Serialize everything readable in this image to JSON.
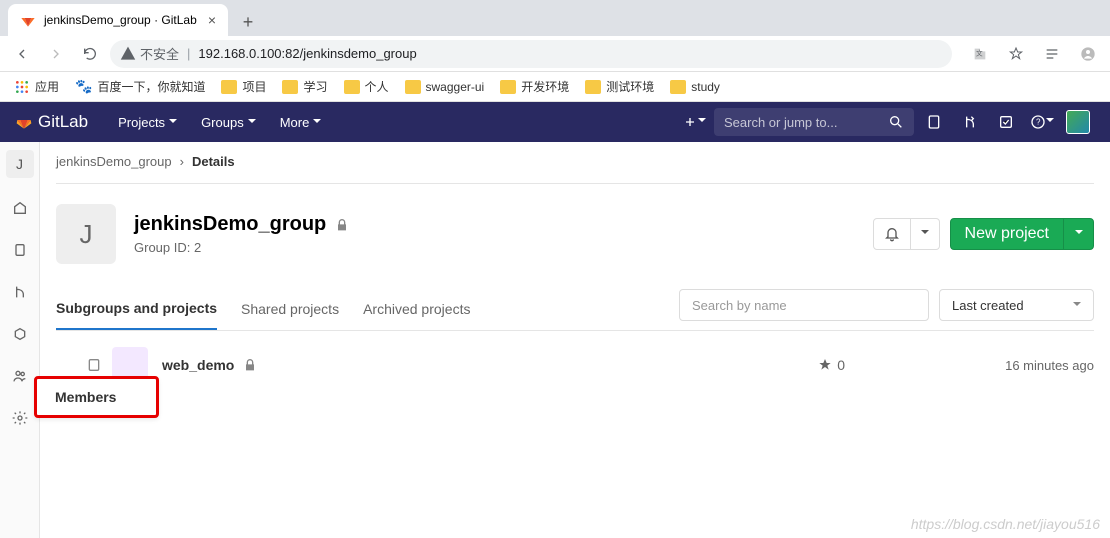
{
  "browser": {
    "tab_title": "jenkinsDemo_group · GitLab",
    "url_warning": "不安全",
    "url": "192.168.0.100:82/jenkinsdemo_group"
  },
  "bookmarks": {
    "apps": "应用",
    "items": [
      "百度一下，你就知道",
      "项目",
      "学习",
      "个人",
      "swagger-ui",
      "开发环境",
      "测试环境",
      "study"
    ]
  },
  "nav": {
    "brand": "GitLab",
    "projects": "Projects",
    "groups": "Groups",
    "more": "More",
    "search_placeholder": "Search or jump to..."
  },
  "sidebar": {
    "avatar_letter": "J"
  },
  "breadcrumb": {
    "group": "jenkinsDemo_group",
    "page": "Details"
  },
  "group": {
    "avatar_letter": "J",
    "title": "jenkinsDemo_group",
    "id_label": "Group ID: 2",
    "new_project": "New project"
  },
  "tabs": {
    "subgroups": "Subgroups and projects",
    "shared": "Shared projects",
    "archived": "Archived projects",
    "search_placeholder": "Search by name",
    "sort": "Last created"
  },
  "project": {
    "name": "web_demo",
    "stars": "0",
    "updated": "16 minutes ago"
  },
  "tooltip": {
    "members": "Members"
  },
  "watermark": "https://blog.csdn.net/jiayou516"
}
